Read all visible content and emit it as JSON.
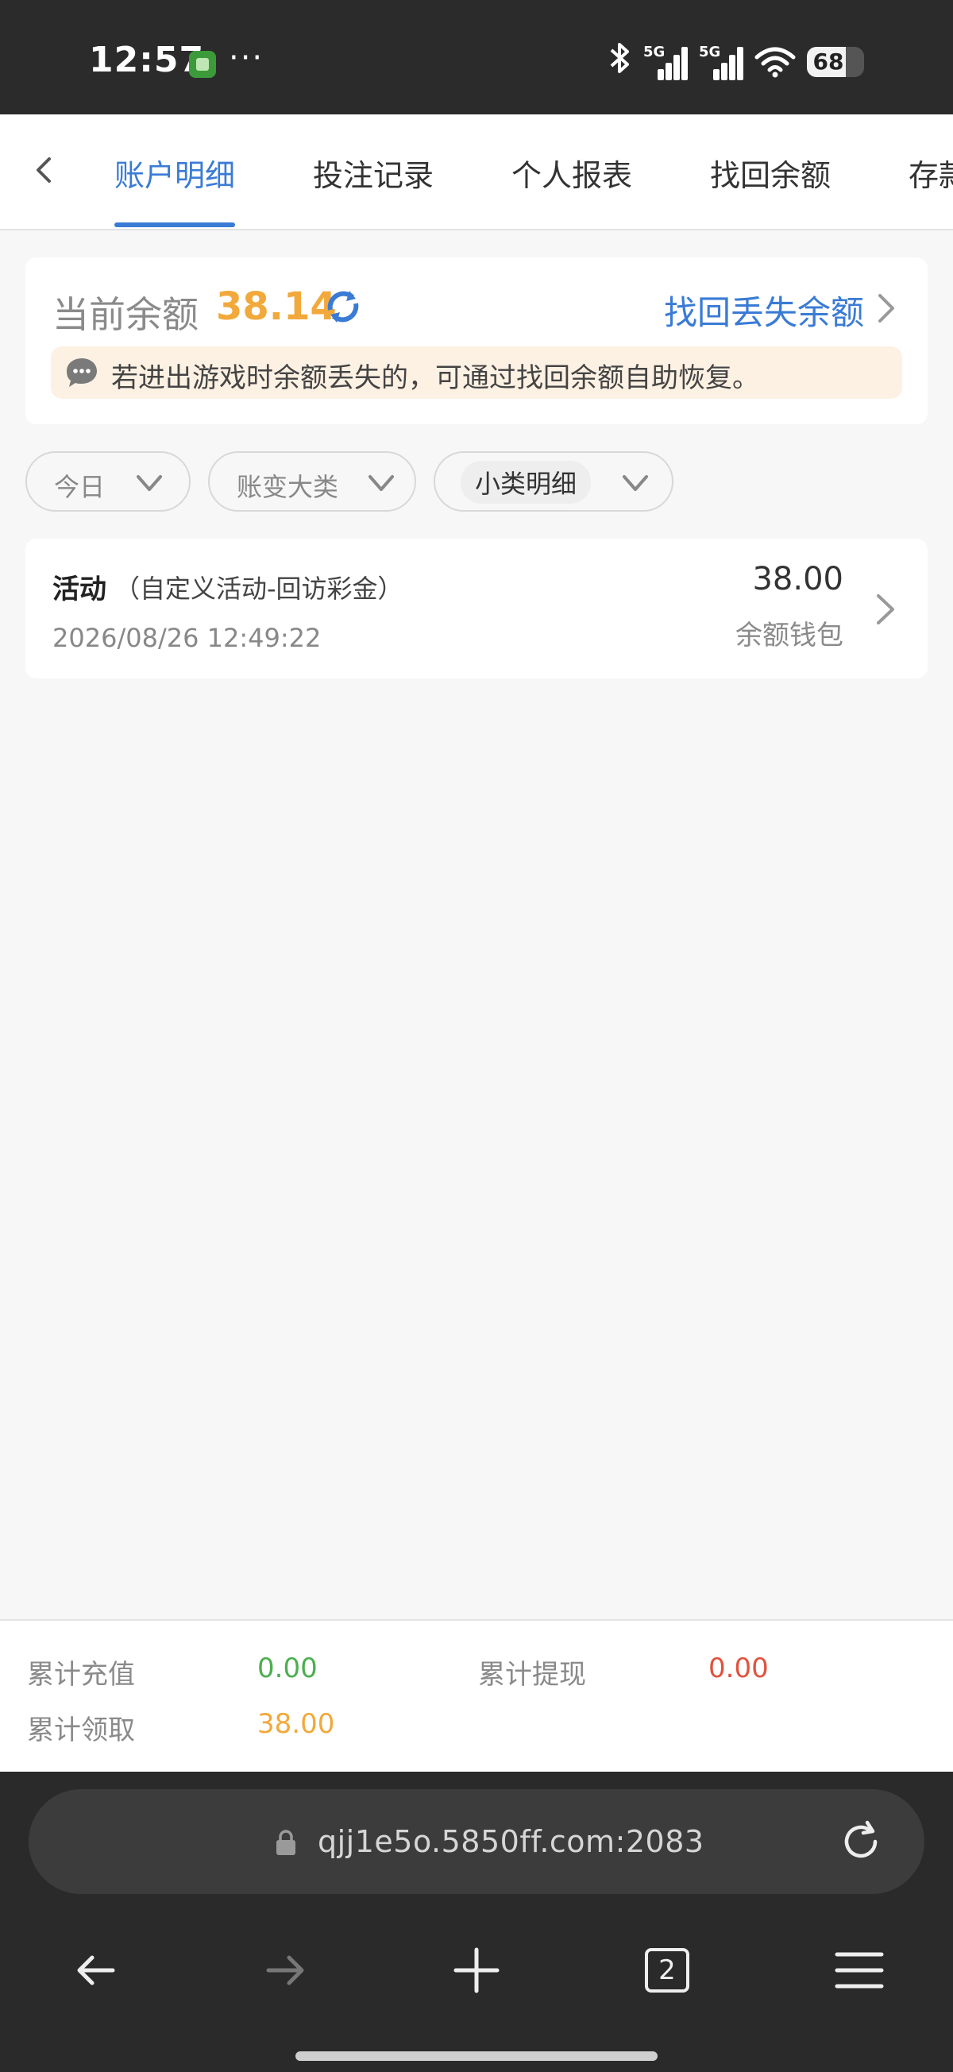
{
  "status_bar": {
    "time": "12:57",
    "more": "···",
    "signal1_tag": "5G",
    "signal2_tag": "5G",
    "battery": "68",
    "icons": [
      "app-icon",
      "bluetooth-icon",
      "signal-icon",
      "wifi-icon",
      "battery-icon"
    ]
  },
  "tabs": [
    {
      "label": "账户明细",
      "active": true
    },
    {
      "label": "投注记录",
      "active": false
    },
    {
      "label": "个人报表",
      "active": false
    },
    {
      "label": "找回余额",
      "active": false
    },
    {
      "label": "存款",
      "active": false
    }
  ],
  "balance": {
    "label": "当前余额",
    "value": "38.14",
    "recover_link": "找回丢失余额",
    "notice": "若进出游戏时余额丢失的，可通过找回余额自助恢复。"
  },
  "filters": [
    {
      "label": "今日",
      "selected": false
    },
    {
      "label": "账变大类",
      "selected": false
    },
    {
      "label": "小类明细",
      "selected": true
    }
  ],
  "records": [
    {
      "type": "活动",
      "sub": "（自定义活动-回访彩金）",
      "date": "2026/08/26 12:49:22",
      "amount": "38.00",
      "wallet": "余额钱包"
    }
  ],
  "summary": {
    "recharge_label": "累计充值",
    "recharge_value": "0.00",
    "withdraw_label": "累计提现",
    "withdraw_value": "0.00",
    "claim_label": "累计领取",
    "claim_value": "38.00"
  },
  "colors": {
    "accent": "#3a7bd5",
    "balance": "#f2a93b",
    "recharge": "#4caf50",
    "withdraw": "#e0533d",
    "claim": "#f2a93b"
  },
  "browser": {
    "url": "qjj1e5o.5850ff.com:2083",
    "tab_count": "2"
  }
}
